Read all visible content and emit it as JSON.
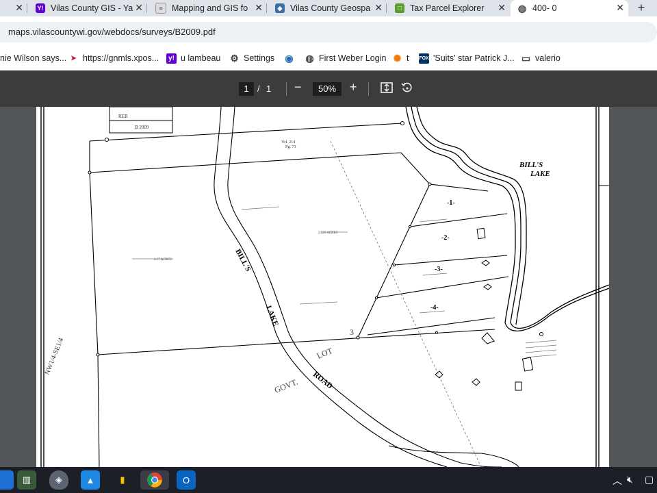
{
  "tabs": [
    {
      "label": "",
      "icon": "partial-tab-icon"
    },
    {
      "label": "Vilas County GIS - Ya",
      "icon": "yahoo-icon"
    },
    {
      "label": "Mapping and GIS fo",
      "icon": "doc-icon"
    },
    {
      "label": "Vilas County Geospa",
      "icon": "county-seal-icon"
    },
    {
      "label": "Tax Parcel Explorer",
      "icon": "tax-parcel-icon"
    },
    {
      "label": "400- 0",
      "icon": "globe-icon",
      "active": true
    }
  ],
  "address": {
    "url": "maps.vilascountywi.gov/webdocs/surveys/B2009.pdf"
  },
  "bookmarks": [
    {
      "label": "nie Wilson says...",
      "icon": "none"
    },
    {
      "label": "https://gnmls.xpos...",
      "icon": "flag-icon"
    },
    {
      "label": "u lambeau",
      "icon": "yahoo-icon"
    },
    {
      "label": "Settings",
      "icon": "gear-icon"
    },
    {
      "label": "",
      "icon": "earth-icon"
    },
    {
      "label": "First Weber Login",
      "icon": "globe-icon"
    },
    {
      "label": "t",
      "icon": "sun-icon"
    },
    {
      "label": "'Suits' star Patrick J...",
      "icon": "fox-news-icon"
    },
    {
      "label": "valerio",
      "icon": "folder-icon"
    }
  ],
  "pdf_toolbar": {
    "page_current": "1",
    "page_separator": "/",
    "page_total": "1",
    "zoom": "50%"
  },
  "drawing": {
    "lake_label_1": "BILL'S",
    "lake_label_2": "LAKE",
    "road_label_1": "BILL'S",
    "road_label_2": "LAKE",
    "road_label_3": "ROAD",
    "govt_label": "GOVT.",
    "lot_label": "LOT",
    "lot_number": "3",
    "nw_label": "NW1/4-SE1/4",
    "vol_label": "Vol. 214",
    "pg_label": "Pg. 73",
    "title_block_initials": "REB",
    "title_block_file_no": "B 2009",
    "lot_numbers": [
      "-1-",
      "-2-",
      "-3-",
      "-4-"
    ],
    "acreage_left": "6.17 ACRES",
    "acreage_mid": "2.525 ACRES"
  },
  "taskbar": {
    "apps": [
      "office-building-icon",
      "shield-app-icon",
      "photos-icon",
      "chart-app-icon",
      "chrome-icon",
      "outlook-icon"
    ],
    "tray": [
      "chevron-up-icon",
      "speaker-muted-icon"
    ]
  },
  "colors": {
    "tab_strip": "#dee3ea",
    "pdf_toolbar": "#3c3c3c",
    "viewer_bg": "#525659",
    "taskbar": "#1c1f26"
  }
}
